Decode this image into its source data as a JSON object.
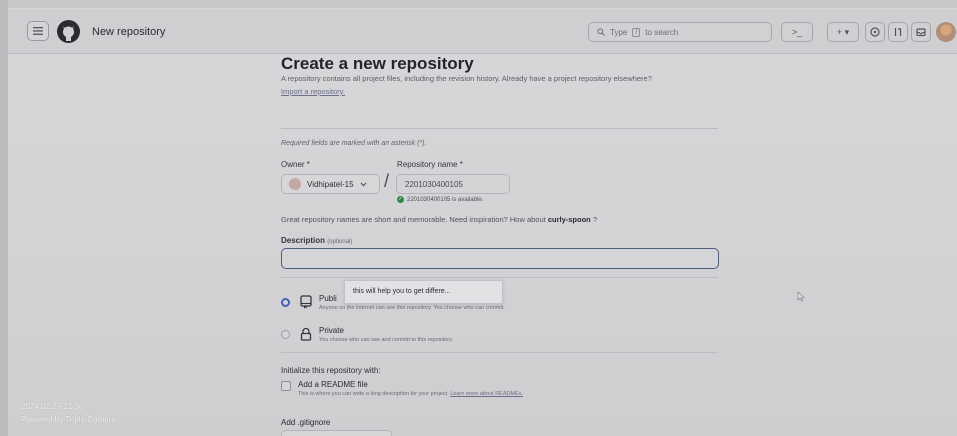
{
  "header": {
    "repo_title": "New repository",
    "search_placeholder_before": "Type",
    "search_key": "/",
    "search_placeholder_after": "to search",
    "terminal_label": ">_",
    "create_label": "+ ▾"
  },
  "form": {
    "title": "Create a new repository",
    "description": "A repository contains all project files, including the revision history. Already have a project repository elsewhere?",
    "import_link": "Import a repository.",
    "required_note": "Required fields are marked with an asterisk (*).",
    "owner_label": "Owner *",
    "owner_value": "Vidhipatel-15",
    "slash": "/",
    "repo_name_label": "Repository name *",
    "repo_name_value": "2201030400105",
    "availability": "2201030400105 is available.",
    "hint_prefix": "Great repository names are short and memorable. Need inspiration? How about",
    "hint_suggestion": "curly-spoon",
    "hint_suffix": "?",
    "description_label": "Description",
    "description_optional": "(optional)",
    "tooltip_text": "this will help you to get differe...",
    "public_title": "Publi",
    "public_sub": "Anyone on the internet can see this repository. You choose who can commit.",
    "private_title": "Private",
    "private_sub": "You choose who can see and commit to this repository.",
    "init_label": "Initialize this repository with:",
    "readme_title": "Add a README file",
    "readme_sub_prefix": "This is where you can write a long description for your project.",
    "readme_link": "Learn more about READMEs.",
    "gitignore_label": "Add .gitignore"
  },
  "camera_stamp": {
    "datetime": "2024.02.29 21:36",
    "caption": "Powered by Triple Camera"
  },
  "colors": {
    "accent_radio": "#3a63b9",
    "available_check": "#2b8a44",
    "focus_border": "#4c5c7e"
  }
}
